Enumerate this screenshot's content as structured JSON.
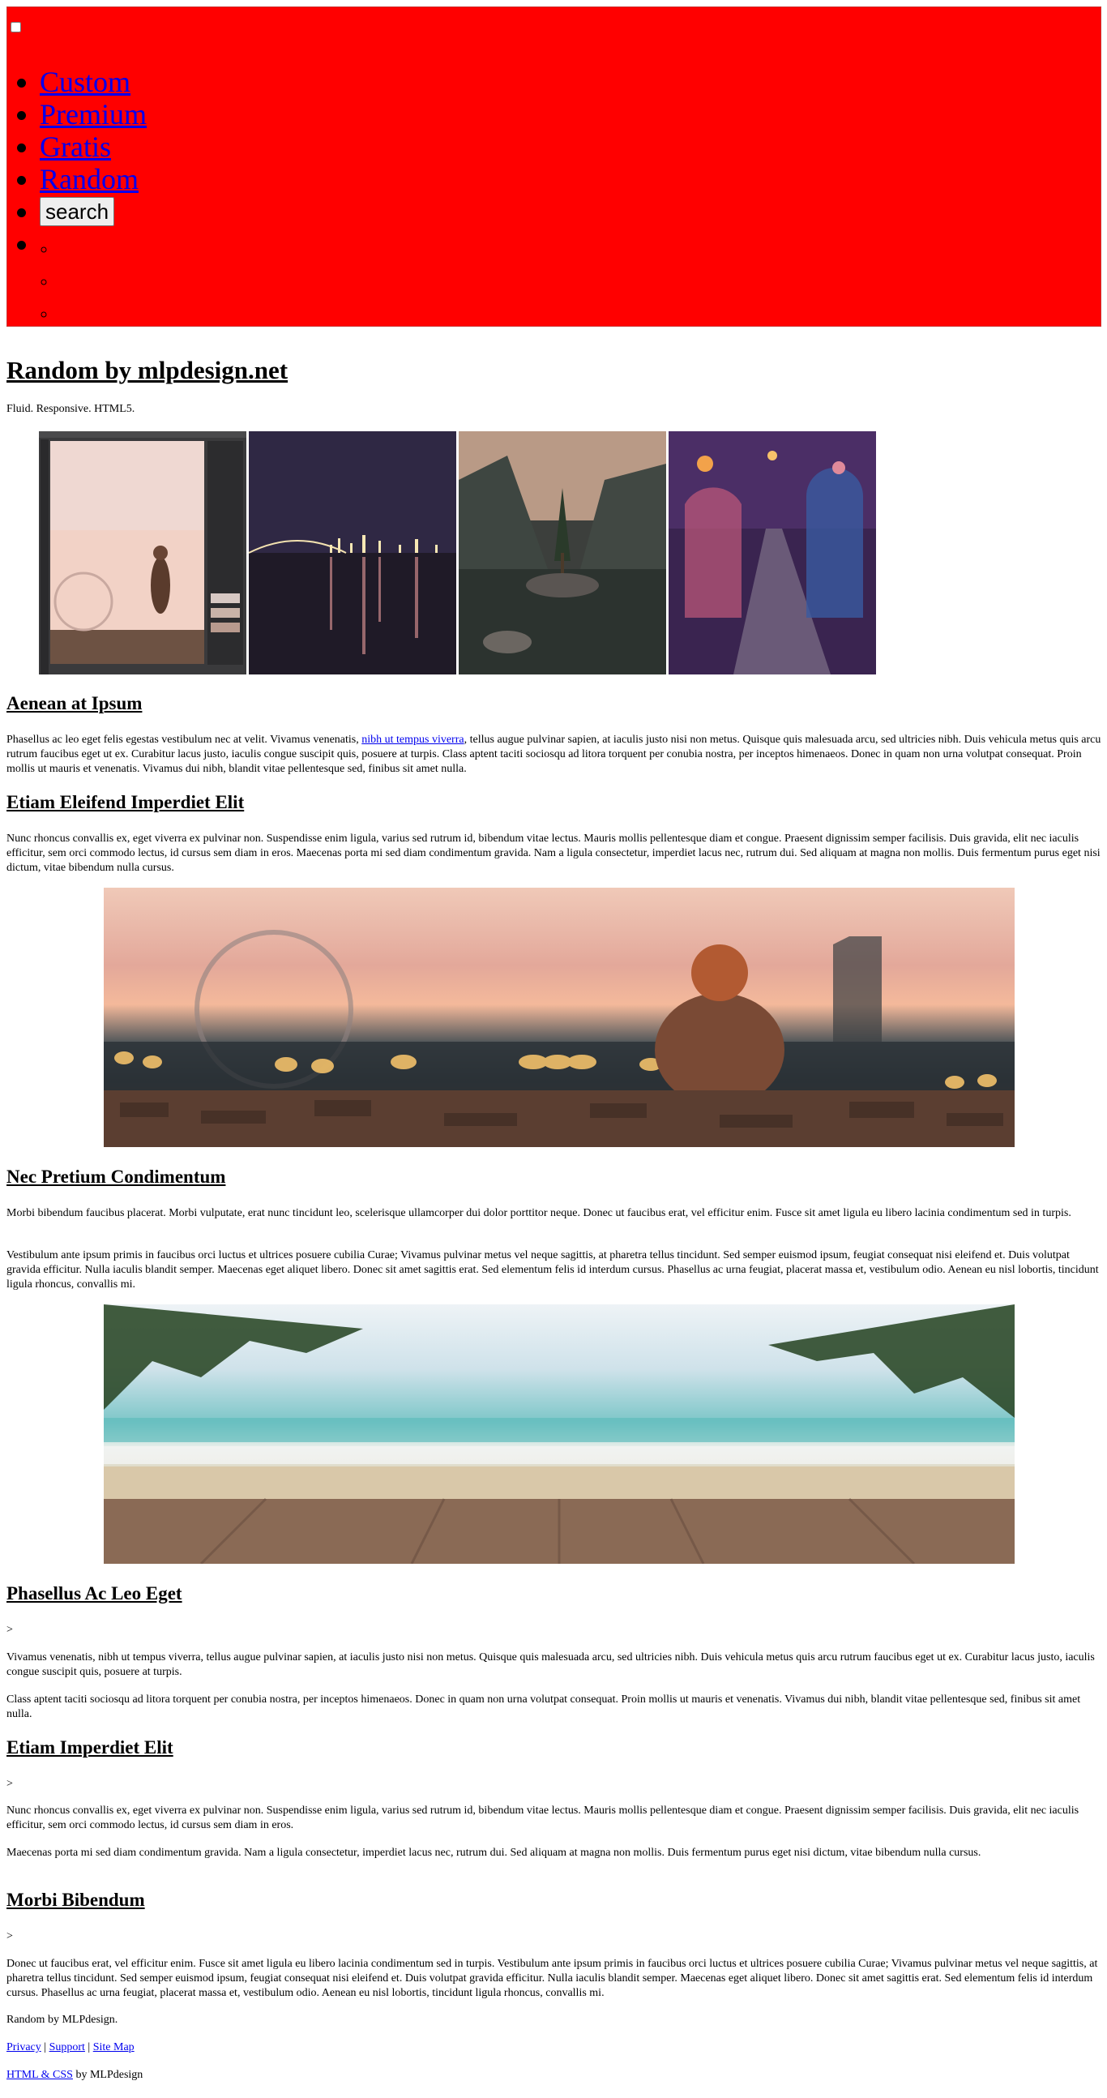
{
  "header": {
    "nav": [
      {
        "label": "Custom"
      },
      {
        "label": "Premium"
      },
      {
        "label": "Gratis"
      },
      {
        "label": "Random"
      }
    ],
    "search_label": "search",
    "background_color": "#ff0000"
  },
  "main": {
    "title": "Random by mlpdesign.net",
    "tagline": "Fluid. Responsive. HTML5.",
    "sections": [
      {
        "heading": "Aenean at Ipsum",
        "p1_before": "Phasellus ac leo eget felis egestas vestibulum nec at velit. Vivamus venenatis, ",
        "p1_link": "nibh ut tempus viverra",
        "p1_after": ", tellus augue pulvinar sapien, at iaculis justo nisi non metus. Quisque quis malesuada arcu, sed ultricies nibh. Duis vehicula metus quis arcu rutrum faucibus eget ut ex. Curabitur lacus justo, iaculis congue suscipit quis, posuere at turpis. Class aptent taciti sociosqu ad litora torquent per conubia nostra, per inceptos himenaeos. Donec in quam non urna volutpat consequat. Proin mollis ut mauris et venenatis. Vivamus dui nibh, blandit vitae pellentesque sed, finibus sit amet nulla."
      },
      {
        "heading": "Etiam Eleifend Imperdiet Elit",
        "p1": "Nunc rhoncus convallis ex, eget viverra ex pulvinar non. Suspendisse enim ligula, varius sed rutrum id, bibendum vitae lectus. Mauris mollis pellentesque diam et congue. Praesent dignissim semper facilisis. Duis gravida, elit nec iaculis efficitur, sem orci commodo lectus, id cursus sem diam in eros. Maecenas porta mi sed diam condimentum gravida. Nam a ligula consectetur, imperdiet lacus nec, rutrum dui. Sed aliquam at magna non mollis. Duis fermentum purus eget nisi dictum, vitae bibendum nulla cursus."
      },
      {
        "heading": "Nec Pretium Condimentum",
        "p1": "Morbi bibendum faucibus placerat. Morbi vulputate, erat nunc tincidunt leo, scelerisque ullamcorper dui dolor porttitor neque. Donec ut faucibus erat, vel efficitur enim. Fusce sit amet ligula eu libero lacinia condimentum sed in turpis.",
        "p2": "Vestibulum ante ipsum primis in faucibus orci luctus et ultrices posuere cubilia Curae; Vivamus pulvinar metus vel neque sagittis, at pharetra tellus tincidunt. Sed semper euismod ipsum, feugiat consequat nisi eleifend et. Duis volutpat gravida efficitur. Nulla iaculis blandit semper. Maecenas eget aliquet libero. Donec sit amet sagittis erat. Sed elementum felis id interdum cursus. Phasellus ac urna feugiat, placerat massa et, vestibulum odio. Aenean eu nisl lobortis, tincidunt ligula rhoncus, convallis mi."
      },
      {
        "heading": "Phasellus Ac Leo Eget",
        "marker": ">",
        "p1": "Vivamus venenatis, nibh ut tempus viverra, tellus augue pulvinar sapien, at iaculis justo nisi non metus. Quisque quis malesuada arcu, sed ultricies nibh. Duis vehicula metus quis arcu rutrum faucibus eget ut ex. Curabitur lacus justo, iaculis congue suscipit quis, posuere at turpis.",
        "p2": "Class aptent taciti sociosqu ad litora torquent per conubia nostra, per inceptos himenaeos. Donec in quam non urna volutpat consequat. Proin mollis ut mauris et venenatis. Vivamus dui nibh, blandit vitae pellentesque sed, finibus sit amet nulla."
      },
      {
        "heading": "Etiam Imperdiet Elit",
        "marker": ">",
        "p1": "Nunc rhoncus convallis ex, eget viverra ex pulvinar non. Suspendisse enim ligula, varius sed rutrum id, bibendum vitae lectus. Mauris mollis pellentesque diam et congue. Praesent dignissim semper facilisis. Duis gravida, elit nec iaculis efficitur, sem orci commodo lectus, id cursus sem diam in eros.",
        "p2": "Maecenas porta mi sed diam condimentum gravida. Nam a ligula consectetur, imperdiet lacus nec, rutrum dui. Sed aliquam at magna non mollis. Duis fermentum purus eget nisi dictum, vitae bibendum nulla cursus."
      },
      {
        "heading": "Morbi Bibendum",
        "marker": ">",
        "p1": "Donec ut faucibus erat, vel efficitur enim. Fusce sit amet ligula eu libero lacinia condimentum sed in turpis. Vestibulum ante ipsum primis in faucibus orci luctus et ultrices posuere cubilia Curae; Vivamus pulvinar metus vel neque sagittis, at pharetra tellus tincidunt. Sed semper euismod ipsum, feugiat consequat nisi eleifend et. Duis volutpat gravida efficitur. Nulla iaculis blandit semper. Maecenas eget aliquet libero. Donec sit amet sagittis erat. Sed elementum felis id interdum cursus. Phasellus ac urna feugiat, placerat massa et, vestibulum odio. Aenean eu nisl lobortis, tincidunt ligula rhoncus, convallis mi."
      }
    ]
  },
  "footer": {
    "credit": "Random by MLPdesign.",
    "links": [
      "Privacy",
      "Support",
      "Site Map"
    ],
    "separator": "|",
    "bottom_link": "HTML & CSS",
    "bottom_suffix": " by MLPdesign"
  }
}
